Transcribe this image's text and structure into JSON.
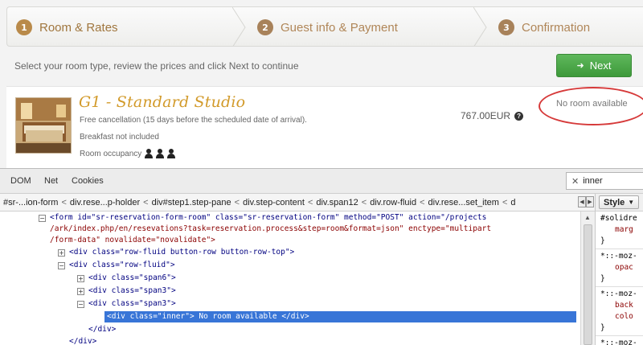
{
  "steps": [
    {
      "num": "1",
      "label": "Room & Rates"
    },
    {
      "num": "2",
      "label": "Guest info & Payment"
    },
    {
      "num": "3",
      "label": "Confirmation"
    }
  ],
  "instructions": "Select your room type, review the prices and click Next to continue",
  "next_button": {
    "label": "Next",
    "icon": "arrow-right-icon"
  },
  "room": {
    "title": "G1 - Standard Studio",
    "cancellation": "Free cancellation (15 days before the scheduled date of arrival).",
    "breakfast": "Breakfast not included",
    "occupancy_label": "Room occupancy",
    "occupancy_count": 3,
    "price": "767.00EUR",
    "availability": "No room available"
  },
  "devtools": {
    "tabs": [
      "DOM",
      "Net",
      "Cookies"
    ],
    "search_value": "inner",
    "breadcrumbs": [
      "#sr-...ion-form",
      "div.rese...p-holder",
      "div#step1.step-pane",
      "div.step-content",
      "div.span12",
      "div.row-fluid",
      "div.rese...set_item",
      "d"
    ],
    "side_button": "Style",
    "html_lines": [
      {
        "l1": "<form id=\"sr-reservation-form-room\" class=\"sr-reservation-form\" method=\"POST\" action=\"/projects",
        "l2": "/ark/index.php/en/resevations?task=reservation.process&step=room&format=json\" enctype=\"multipart",
        "l3": "/form-data\" novalidate=\"novalidate\">"
      },
      {
        "text": "<div class=\"row-fluid button-row button-row-top\">"
      },
      {
        "text": "<div class=\"row-fluid\">"
      },
      {
        "text": "<div class=\"span6\">"
      },
      {
        "text": "<div class=\"span3\">"
      },
      {
        "text": "<div class=\"span3\">"
      },
      {
        "text": "<div class=\"inner\"> No room available </div>"
      },
      {
        "text": "</div>"
      },
      {
        "text": "</div>"
      }
    ],
    "style_lines": [
      "#solidre",
      "marg",
      "}",
      "*::-moz-",
      "opac",
      "}",
      "*::-moz-",
      "back",
      "colo",
      "}",
      "*::-moz-"
    ]
  }
}
